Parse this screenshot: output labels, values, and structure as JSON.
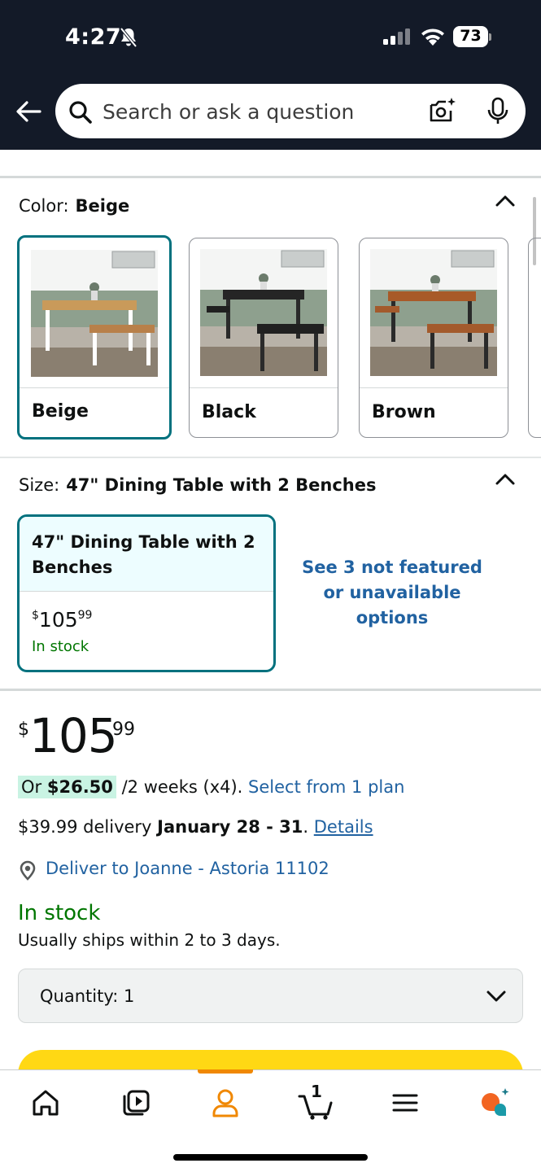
{
  "status_bar": {
    "time": "4:27",
    "battery": "73"
  },
  "search": {
    "placeholder": "Search or ask a question"
  },
  "color_section": {
    "label": "Color:",
    "value": "Beige",
    "options": [
      {
        "label": "Beige",
        "selected": true
      },
      {
        "label": "Black",
        "selected": false
      },
      {
        "label": "Brown",
        "selected": false
      }
    ]
  },
  "size_section": {
    "label": "Size:",
    "value": "47\" Dining Table with 2 Benches",
    "card": {
      "name": "47\" Dining Table with 2 Benches",
      "price_symbol": "$",
      "price_whole": "105",
      "price_fraction": "99",
      "stock": "In stock"
    },
    "more_options": "See 3 not featured or unavailable options"
  },
  "price": {
    "symbol": "$",
    "whole": "105",
    "fraction": "99"
  },
  "installment": {
    "prefix": "Or",
    "amount": "$26.50",
    "terms": "/2 weeks (x4).",
    "link": "Select from 1 plan"
  },
  "delivery": {
    "cost_text": "$39.99 delivery",
    "dates": "January 28 - 31",
    "period": ".",
    "details_link": "Details"
  },
  "deliver_to": "Deliver to Joanne - Astoria 11102",
  "availability": {
    "status": "In stock",
    "shipping_note": "Usually ships within 2 to 3 days."
  },
  "quantity": {
    "label": "Quantity: 1"
  },
  "tabbar": {
    "tabs": [
      {
        "icon": "home-icon"
      },
      {
        "icon": "video-icon"
      },
      {
        "icon": "account-icon",
        "active": true
      },
      {
        "icon": "cart-icon",
        "count": "1"
      },
      {
        "icon": "menu-icon"
      },
      {
        "icon": "rufus-assistant-icon"
      }
    ]
  },
  "colors": {
    "header_bg": "#131a28",
    "selected_border": "#00717e",
    "link": "#2162a1",
    "in_stock": "#007600",
    "buy_button": "#ffd814",
    "active_tab": "#f08804"
  }
}
